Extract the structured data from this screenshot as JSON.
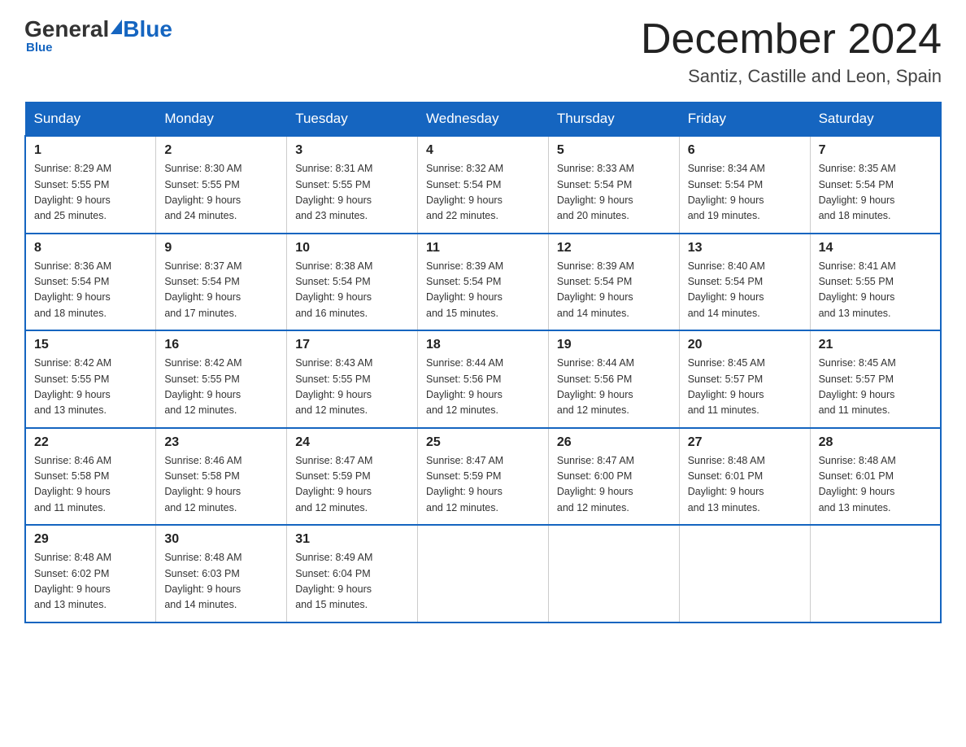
{
  "logo": {
    "general": "General",
    "blue": "Blue"
  },
  "header": {
    "month": "December 2024",
    "location": "Santiz, Castille and Leon, Spain"
  },
  "days_of_week": [
    "Sunday",
    "Monday",
    "Tuesday",
    "Wednesday",
    "Thursday",
    "Friday",
    "Saturday"
  ],
  "weeks": [
    [
      {
        "day": "1",
        "info": "Sunrise: 8:29 AM\nSunset: 5:55 PM\nDaylight: 9 hours\nand 25 minutes."
      },
      {
        "day": "2",
        "info": "Sunrise: 8:30 AM\nSunset: 5:55 PM\nDaylight: 9 hours\nand 24 minutes."
      },
      {
        "day": "3",
        "info": "Sunrise: 8:31 AM\nSunset: 5:55 PM\nDaylight: 9 hours\nand 23 minutes."
      },
      {
        "day": "4",
        "info": "Sunrise: 8:32 AM\nSunset: 5:54 PM\nDaylight: 9 hours\nand 22 minutes."
      },
      {
        "day": "5",
        "info": "Sunrise: 8:33 AM\nSunset: 5:54 PM\nDaylight: 9 hours\nand 20 minutes."
      },
      {
        "day": "6",
        "info": "Sunrise: 8:34 AM\nSunset: 5:54 PM\nDaylight: 9 hours\nand 19 minutes."
      },
      {
        "day": "7",
        "info": "Sunrise: 8:35 AM\nSunset: 5:54 PM\nDaylight: 9 hours\nand 18 minutes."
      }
    ],
    [
      {
        "day": "8",
        "info": "Sunrise: 8:36 AM\nSunset: 5:54 PM\nDaylight: 9 hours\nand 18 minutes."
      },
      {
        "day": "9",
        "info": "Sunrise: 8:37 AM\nSunset: 5:54 PM\nDaylight: 9 hours\nand 17 minutes."
      },
      {
        "day": "10",
        "info": "Sunrise: 8:38 AM\nSunset: 5:54 PM\nDaylight: 9 hours\nand 16 minutes."
      },
      {
        "day": "11",
        "info": "Sunrise: 8:39 AM\nSunset: 5:54 PM\nDaylight: 9 hours\nand 15 minutes."
      },
      {
        "day": "12",
        "info": "Sunrise: 8:39 AM\nSunset: 5:54 PM\nDaylight: 9 hours\nand 14 minutes."
      },
      {
        "day": "13",
        "info": "Sunrise: 8:40 AM\nSunset: 5:54 PM\nDaylight: 9 hours\nand 14 minutes."
      },
      {
        "day": "14",
        "info": "Sunrise: 8:41 AM\nSunset: 5:55 PM\nDaylight: 9 hours\nand 13 minutes."
      }
    ],
    [
      {
        "day": "15",
        "info": "Sunrise: 8:42 AM\nSunset: 5:55 PM\nDaylight: 9 hours\nand 13 minutes."
      },
      {
        "day": "16",
        "info": "Sunrise: 8:42 AM\nSunset: 5:55 PM\nDaylight: 9 hours\nand 12 minutes."
      },
      {
        "day": "17",
        "info": "Sunrise: 8:43 AM\nSunset: 5:55 PM\nDaylight: 9 hours\nand 12 minutes."
      },
      {
        "day": "18",
        "info": "Sunrise: 8:44 AM\nSunset: 5:56 PM\nDaylight: 9 hours\nand 12 minutes."
      },
      {
        "day": "19",
        "info": "Sunrise: 8:44 AM\nSunset: 5:56 PM\nDaylight: 9 hours\nand 12 minutes."
      },
      {
        "day": "20",
        "info": "Sunrise: 8:45 AM\nSunset: 5:57 PM\nDaylight: 9 hours\nand 11 minutes."
      },
      {
        "day": "21",
        "info": "Sunrise: 8:45 AM\nSunset: 5:57 PM\nDaylight: 9 hours\nand 11 minutes."
      }
    ],
    [
      {
        "day": "22",
        "info": "Sunrise: 8:46 AM\nSunset: 5:58 PM\nDaylight: 9 hours\nand 11 minutes."
      },
      {
        "day": "23",
        "info": "Sunrise: 8:46 AM\nSunset: 5:58 PM\nDaylight: 9 hours\nand 12 minutes."
      },
      {
        "day": "24",
        "info": "Sunrise: 8:47 AM\nSunset: 5:59 PM\nDaylight: 9 hours\nand 12 minutes."
      },
      {
        "day": "25",
        "info": "Sunrise: 8:47 AM\nSunset: 5:59 PM\nDaylight: 9 hours\nand 12 minutes."
      },
      {
        "day": "26",
        "info": "Sunrise: 8:47 AM\nSunset: 6:00 PM\nDaylight: 9 hours\nand 12 minutes."
      },
      {
        "day": "27",
        "info": "Sunrise: 8:48 AM\nSunset: 6:01 PM\nDaylight: 9 hours\nand 13 minutes."
      },
      {
        "day": "28",
        "info": "Sunrise: 8:48 AM\nSunset: 6:01 PM\nDaylight: 9 hours\nand 13 minutes."
      }
    ],
    [
      {
        "day": "29",
        "info": "Sunrise: 8:48 AM\nSunset: 6:02 PM\nDaylight: 9 hours\nand 13 minutes."
      },
      {
        "day": "30",
        "info": "Sunrise: 8:48 AM\nSunset: 6:03 PM\nDaylight: 9 hours\nand 14 minutes."
      },
      {
        "day": "31",
        "info": "Sunrise: 8:49 AM\nSunset: 6:04 PM\nDaylight: 9 hours\nand 15 minutes."
      },
      {
        "day": "",
        "info": ""
      },
      {
        "day": "",
        "info": ""
      },
      {
        "day": "",
        "info": ""
      },
      {
        "day": "",
        "info": ""
      }
    ]
  ],
  "colors": {
    "header_bg": "#1565c0",
    "header_text": "#ffffff",
    "border": "#1565c0",
    "cell_border": "#cccccc"
  }
}
